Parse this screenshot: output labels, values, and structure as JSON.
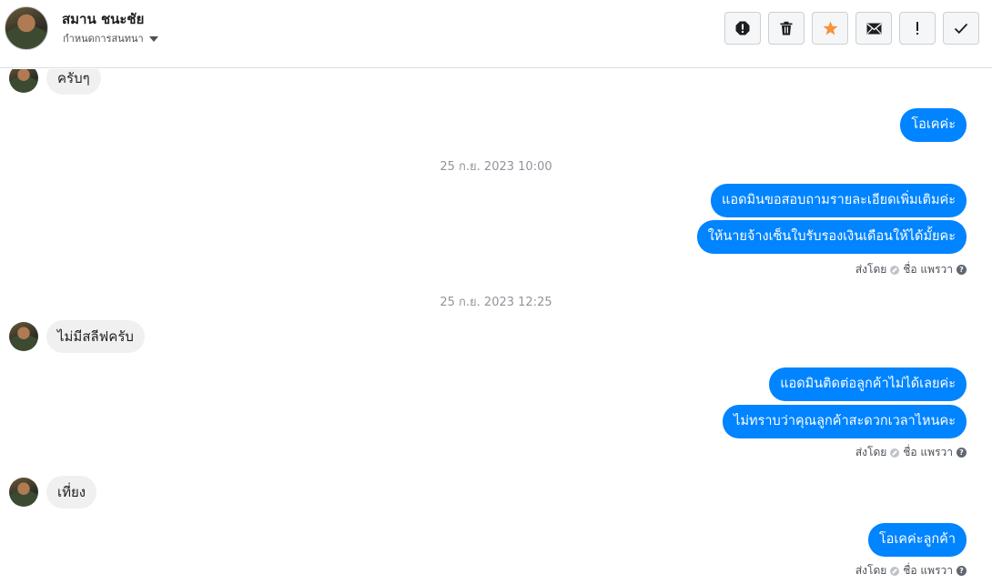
{
  "header": {
    "contact_name": "สมาน ชนะชัย",
    "convo_label": "กำหนดการสนทนา"
  },
  "actions": [
    {
      "name": "spam-button",
      "icon": "alert-octagon-icon"
    },
    {
      "name": "delete-button",
      "icon": "trash-icon"
    },
    {
      "name": "star-button",
      "icon": "star-icon",
      "color": "#f7923b"
    },
    {
      "name": "mark-unread-button",
      "icon": "envelope-icon"
    },
    {
      "name": "important-button",
      "icon": "exclamation-icon"
    },
    {
      "name": "done-button",
      "icon": "check-icon"
    }
  ],
  "messages": {
    "m1": "ครับๆ",
    "m2": "โอเคค่ะ",
    "ts1": "25 ก.ย. 2023 10:00",
    "m3": "แอดมินขอสอบถามรายละเอียดเพิ่มเติมค่ะ",
    "m4": "ให้นายจ้างเซ็นใบรับรองเงินเดือนให้ได้มั้ยคะ",
    "ts2": "25 ก.ย. 2023 12:25",
    "m5": "ไม่มีสลีฟครับ",
    "m6": "แอดมินติดต่อลูกค้าไม่ได้เลยค่ะ",
    "m7": "ไม่ทราบว่าคุณลูกค้าสะดวกเวลาไหนคะ",
    "m8": "เที่ยง",
    "m9": "โอเคค่ะลูกค้า"
  },
  "sent_by": {
    "prefix": "ส่งโดย",
    "name": "ชื่อ แพรวา",
    "help": "?"
  },
  "colors": {
    "outgoing_bubble": "#0084ff",
    "incoming_bubble": "#f1f0f0",
    "star": "#f7923b"
  }
}
